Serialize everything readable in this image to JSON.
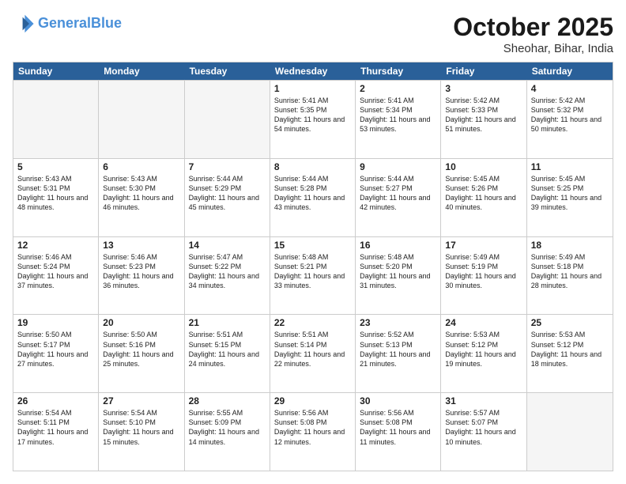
{
  "logo": {
    "line1": "General",
    "line2": "Blue"
  },
  "title": "October 2025",
  "location": "Sheohar, Bihar, India",
  "days": [
    "Sunday",
    "Monday",
    "Tuesday",
    "Wednesday",
    "Thursday",
    "Friday",
    "Saturday"
  ],
  "rows": [
    [
      {
        "num": "",
        "info": ""
      },
      {
        "num": "",
        "info": ""
      },
      {
        "num": "",
        "info": ""
      },
      {
        "num": "1",
        "info": "Sunrise: 5:41 AM\nSunset: 5:35 PM\nDaylight: 11 hours\nand 54 minutes."
      },
      {
        "num": "2",
        "info": "Sunrise: 5:41 AM\nSunset: 5:34 PM\nDaylight: 11 hours\nand 53 minutes."
      },
      {
        "num": "3",
        "info": "Sunrise: 5:42 AM\nSunset: 5:33 PM\nDaylight: 11 hours\nand 51 minutes."
      },
      {
        "num": "4",
        "info": "Sunrise: 5:42 AM\nSunset: 5:32 PM\nDaylight: 11 hours\nand 50 minutes."
      }
    ],
    [
      {
        "num": "5",
        "info": "Sunrise: 5:43 AM\nSunset: 5:31 PM\nDaylight: 11 hours\nand 48 minutes."
      },
      {
        "num": "6",
        "info": "Sunrise: 5:43 AM\nSunset: 5:30 PM\nDaylight: 11 hours\nand 46 minutes."
      },
      {
        "num": "7",
        "info": "Sunrise: 5:44 AM\nSunset: 5:29 PM\nDaylight: 11 hours\nand 45 minutes."
      },
      {
        "num": "8",
        "info": "Sunrise: 5:44 AM\nSunset: 5:28 PM\nDaylight: 11 hours\nand 43 minutes."
      },
      {
        "num": "9",
        "info": "Sunrise: 5:44 AM\nSunset: 5:27 PM\nDaylight: 11 hours\nand 42 minutes."
      },
      {
        "num": "10",
        "info": "Sunrise: 5:45 AM\nSunset: 5:26 PM\nDaylight: 11 hours\nand 40 minutes."
      },
      {
        "num": "11",
        "info": "Sunrise: 5:45 AM\nSunset: 5:25 PM\nDaylight: 11 hours\nand 39 minutes."
      }
    ],
    [
      {
        "num": "12",
        "info": "Sunrise: 5:46 AM\nSunset: 5:24 PM\nDaylight: 11 hours\nand 37 minutes."
      },
      {
        "num": "13",
        "info": "Sunrise: 5:46 AM\nSunset: 5:23 PM\nDaylight: 11 hours\nand 36 minutes."
      },
      {
        "num": "14",
        "info": "Sunrise: 5:47 AM\nSunset: 5:22 PM\nDaylight: 11 hours\nand 34 minutes."
      },
      {
        "num": "15",
        "info": "Sunrise: 5:48 AM\nSunset: 5:21 PM\nDaylight: 11 hours\nand 33 minutes."
      },
      {
        "num": "16",
        "info": "Sunrise: 5:48 AM\nSunset: 5:20 PM\nDaylight: 11 hours\nand 31 minutes."
      },
      {
        "num": "17",
        "info": "Sunrise: 5:49 AM\nSunset: 5:19 PM\nDaylight: 11 hours\nand 30 minutes."
      },
      {
        "num": "18",
        "info": "Sunrise: 5:49 AM\nSunset: 5:18 PM\nDaylight: 11 hours\nand 28 minutes."
      }
    ],
    [
      {
        "num": "19",
        "info": "Sunrise: 5:50 AM\nSunset: 5:17 PM\nDaylight: 11 hours\nand 27 minutes."
      },
      {
        "num": "20",
        "info": "Sunrise: 5:50 AM\nSunset: 5:16 PM\nDaylight: 11 hours\nand 25 minutes."
      },
      {
        "num": "21",
        "info": "Sunrise: 5:51 AM\nSunset: 5:15 PM\nDaylight: 11 hours\nand 24 minutes."
      },
      {
        "num": "22",
        "info": "Sunrise: 5:51 AM\nSunset: 5:14 PM\nDaylight: 11 hours\nand 22 minutes."
      },
      {
        "num": "23",
        "info": "Sunrise: 5:52 AM\nSunset: 5:13 PM\nDaylight: 11 hours\nand 21 minutes."
      },
      {
        "num": "24",
        "info": "Sunrise: 5:53 AM\nSunset: 5:12 PM\nDaylight: 11 hours\nand 19 minutes."
      },
      {
        "num": "25",
        "info": "Sunrise: 5:53 AM\nSunset: 5:12 PM\nDaylight: 11 hours\nand 18 minutes."
      }
    ],
    [
      {
        "num": "26",
        "info": "Sunrise: 5:54 AM\nSunset: 5:11 PM\nDaylight: 11 hours\nand 17 minutes."
      },
      {
        "num": "27",
        "info": "Sunrise: 5:54 AM\nSunset: 5:10 PM\nDaylight: 11 hours\nand 15 minutes."
      },
      {
        "num": "28",
        "info": "Sunrise: 5:55 AM\nSunset: 5:09 PM\nDaylight: 11 hours\nand 14 minutes."
      },
      {
        "num": "29",
        "info": "Sunrise: 5:56 AM\nSunset: 5:08 PM\nDaylight: 11 hours\nand 12 minutes."
      },
      {
        "num": "30",
        "info": "Sunrise: 5:56 AM\nSunset: 5:08 PM\nDaylight: 11 hours\nand 11 minutes."
      },
      {
        "num": "31",
        "info": "Sunrise: 5:57 AM\nSunset: 5:07 PM\nDaylight: 11 hours\nand 10 minutes."
      },
      {
        "num": "",
        "info": ""
      }
    ]
  ]
}
